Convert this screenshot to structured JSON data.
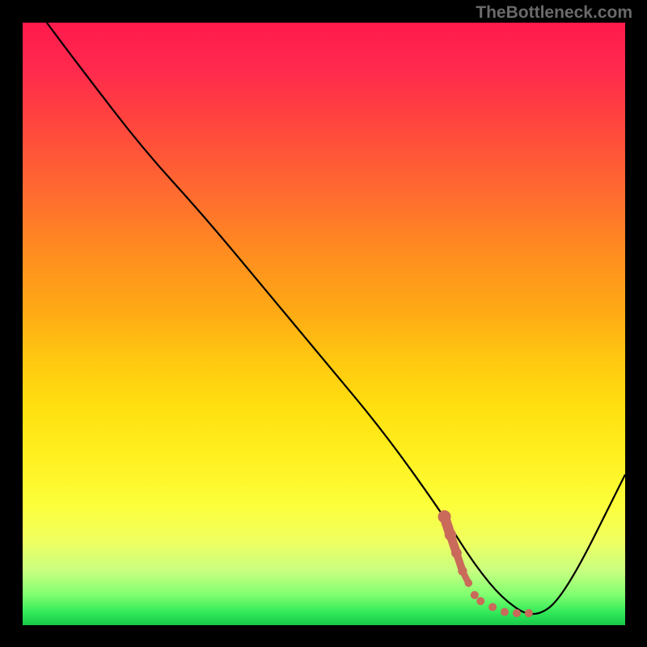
{
  "watermark": "TheBottleneck.com",
  "chart_data": {
    "type": "line",
    "title": "",
    "xlabel": "",
    "ylabel": "",
    "xlim": [
      0,
      100
    ],
    "ylim": [
      0,
      100
    ],
    "series": [
      {
        "name": "bottleneck-curve",
        "x": [
          4,
          10,
          20,
          30,
          40,
          50,
          60,
          70,
          75,
          80,
          85,
          90,
          100
        ],
        "y": [
          100,
          92,
          79,
          68,
          56,
          44,
          32,
          18,
          10,
          4,
          1,
          5,
          25
        ],
        "color": "#000000"
      },
      {
        "name": "optimal-marker",
        "x": [
          70,
          71,
          72,
          73,
          74,
          75,
          76,
          78,
          80,
          82,
          84
        ],
        "y": [
          18,
          15,
          12,
          9,
          7,
          5,
          4,
          3,
          2.2,
          2,
          2
        ],
        "color": "#c96a5a",
        "style": "dotted"
      }
    ],
    "gradient_stops": [
      {
        "pos": 0,
        "color": "#ff1a4d"
      },
      {
        "pos": 15,
        "color": "#ff4040"
      },
      {
        "pos": 38,
        "color": "#ff8c20"
      },
      {
        "pos": 64,
        "color": "#ffe010"
      },
      {
        "pos": 86,
        "color": "#f0ff60"
      },
      {
        "pos": 100,
        "color": "#18c848"
      }
    ]
  }
}
